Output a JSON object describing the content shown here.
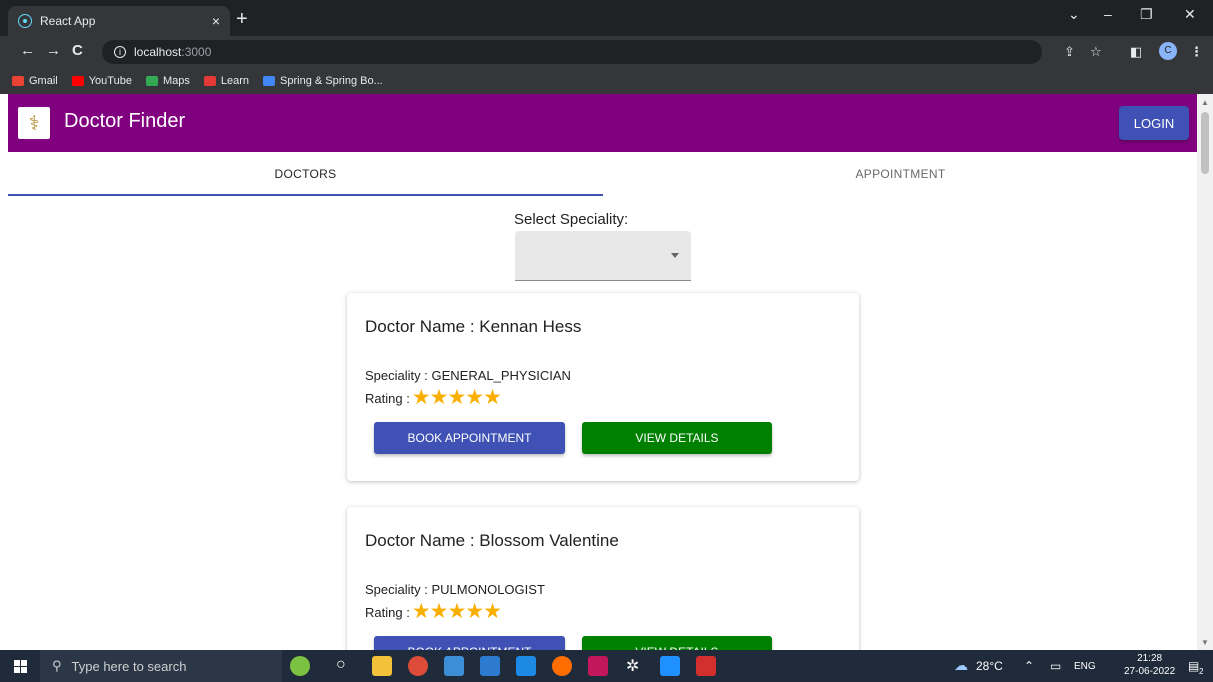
{
  "browser": {
    "tab_title": "React App",
    "tab_close": "×",
    "new_tab": "+",
    "url_host": "localhost",
    "url_port": ":3000",
    "bookmarks": [
      {
        "label": "Gmail",
        "color": "#ea4335"
      },
      {
        "label": "YouTube",
        "color": "#ff0000"
      },
      {
        "label": "Maps",
        "color": "#34a853"
      },
      {
        "label": "Learn",
        "color": "#e53935"
      },
      {
        "label": "Spring & Spring Bo...",
        "color": "#4285f4"
      }
    ],
    "profile_initial": "C"
  },
  "app": {
    "title": "Doctor Finder",
    "login_label": "LOGIN",
    "brand_color": "#800080",
    "tabs": [
      {
        "label": "DOCTORS",
        "active": true
      },
      {
        "label": "APPOINTMENT",
        "active": false
      }
    ],
    "speciality_label": "Select Speciality:",
    "speciality_value": "",
    "doctors": [
      {
        "name": "Doctor Name : Kennan Hess",
        "speciality": "Speciality : GENERAL_PHYSICIAN",
        "rating_label": "Rating :",
        "rating": 5,
        "stars": "★★★★★"
      },
      {
        "name": "Doctor Name : Blossom Valentine",
        "speciality": "Speciality : PULMONOLOGIST",
        "rating_label": "Rating :",
        "rating": 5,
        "stars": "★★★★★"
      }
    ],
    "book_label": "BOOK APPOINTMENT",
    "view_label": "VIEW DETAILS"
  },
  "taskbar": {
    "search_placeholder": "Type here to search",
    "weather": "28°C",
    "language": "ENG",
    "time": "21:28",
    "date": "27-06-2022",
    "notifications": "2"
  }
}
